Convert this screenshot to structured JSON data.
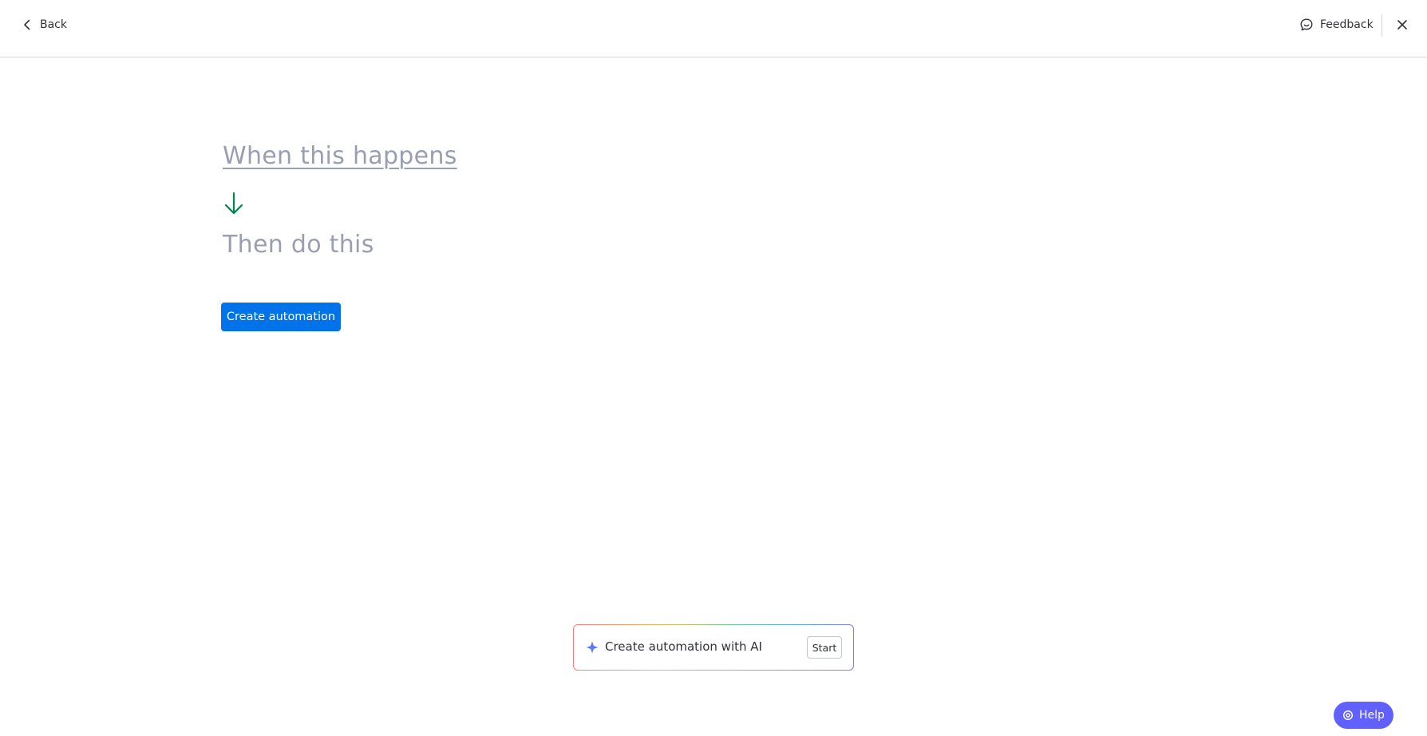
{
  "header": {
    "back_label": "Back",
    "feedback_label": "Feedback"
  },
  "recipe": {
    "trigger_label": "When this happens",
    "action_label": "Then do this",
    "create_button_label": "Create automation"
  },
  "ai_bar": {
    "label": "Create automation with AI",
    "start_label": "Start"
  },
  "help": {
    "label": "Help"
  },
  "colors": {
    "primary": "#0073ea",
    "arrow": "#00854d",
    "placeholder_text": "#9a9eb3",
    "help": "#6161ff"
  },
  "icons": {
    "back": "chevron-left-icon",
    "feedback": "feedback-icon",
    "close": "close-icon",
    "arrow": "arrow-down-icon",
    "ai": "ai-sparkle-icon",
    "help": "help-icon"
  }
}
